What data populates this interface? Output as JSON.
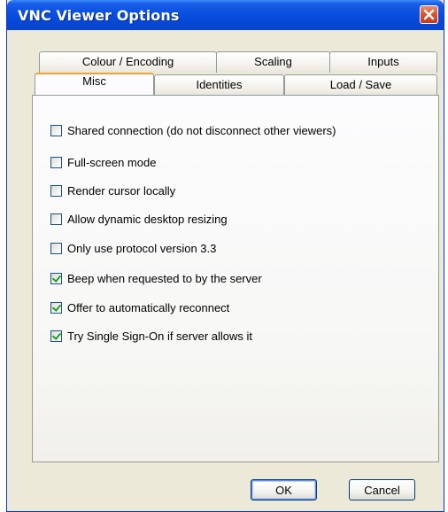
{
  "window": {
    "title": "VNC Viewer Options"
  },
  "tabs": {
    "row_back": [
      {
        "label": "Colour / Encoding"
      },
      {
        "label": "Scaling"
      },
      {
        "label": "Inputs"
      }
    ],
    "row_front": [
      {
        "label": "Misc",
        "active": true
      },
      {
        "label": "Identities"
      },
      {
        "label": "Load / Save"
      }
    ]
  },
  "options": [
    {
      "label": "Shared connection (do not disconnect other viewers)",
      "checked": false
    },
    {
      "label": "Full-screen mode",
      "checked": false
    },
    {
      "label": "Render cursor locally",
      "checked": false
    },
    {
      "label": "Allow dynamic desktop resizing",
      "checked": false
    },
    {
      "label": "Only use protocol version 3.3",
      "checked": false
    },
    {
      "label": "Beep when requested to by the server",
      "checked": true
    },
    {
      "label": "Offer to automatically reconnect",
      "checked": true
    },
    {
      "label": "Try Single Sign-On if server allows it",
      "checked": true
    }
  ],
  "buttons": {
    "ok": "OK",
    "cancel": "Cancel"
  },
  "colors": {
    "title_bar": "#0a52df",
    "active_tab_accent": "#e8a23a",
    "check_mark": "#21a121",
    "close_button": "#e2542f"
  },
  "icons": {
    "close": "close-icon"
  }
}
